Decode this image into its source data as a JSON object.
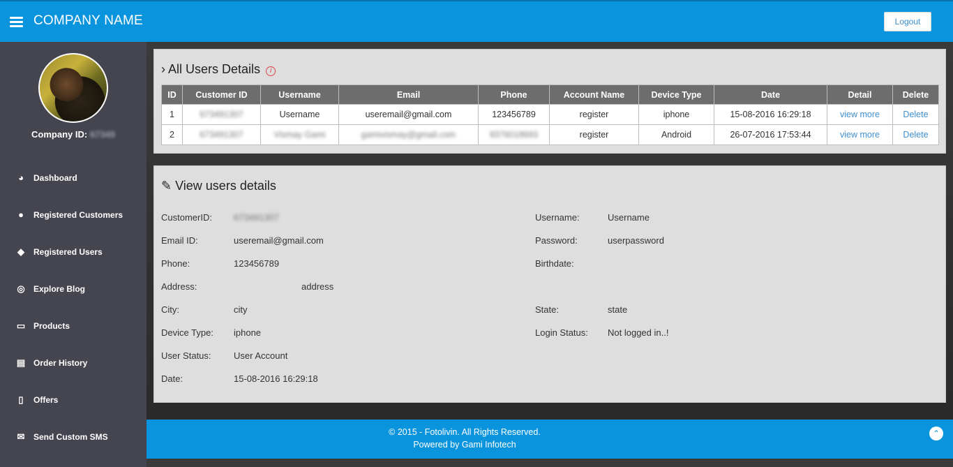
{
  "header": {
    "menu_icon": "hamburger-icon",
    "brand": "COMPANY NAME",
    "logout_label": "Logout"
  },
  "sidebar": {
    "company_id_label": "Company ID:",
    "company_id_value": "67349",
    "items": [
      {
        "label": "Dashboard",
        "icon": "dashboard-icon",
        "glyph": "◕"
      },
      {
        "label": "Registered Customers",
        "icon": "user-icon",
        "glyph": "●"
      },
      {
        "label": "Registered Users",
        "icon": "users-icon",
        "glyph": "◆"
      },
      {
        "label": "Explore Blog",
        "icon": "compass-icon",
        "glyph": "◎"
      },
      {
        "label": "Products",
        "icon": "product-icon",
        "glyph": "▭"
      },
      {
        "label": "Order History",
        "icon": "book-icon",
        "glyph": "▤"
      },
      {
        "label": "Offers",
        "icon": "mobile-icon",
        "glyph": "▯"
      },
      {
        "label": "Send Custom SMS",
        "icon": "envelope-icon",
        "glyph": "✉"
      }
    ]
  },
  "users_panel": {
    "title": "All Users Details",
    "columns": [
      "ID",
      "Customer ID",
      "Username",
      "Email",
      "Phone",
      "Account Name",
      "Device Type",
      "Date",
      "Detail",
      "Delete"
    ],
    "rows": [
      {
        "id": "1",
        "customer_id": "673491307",
        "username": "Username",
        "email": "useremail@gmail.com",
        "phone": "123456789",
        "account_name": "register",
        "device_type": "iphone",
        "date": "15-08-2016 16:29:18",
        "detail": "view more",
        "delete": "Delete"
      },
      {
        "id": "2",
        "customer_id": "673491307",
        "username": "Vismay Gami",
        "email": "gamivismay@gmail.com",
        "phone": "9376018693",
        "account_name": "register",
        "device_type": "Android",
        "date": "26-07-2016 17:53:44",
        "detail": "view more",
        "delete": "Delete"
      }
    ]
  },
  "details_panel": {
    "title": "View users details",
    "left": [
      {
        "label": "CustomerID:",
        "value": "673491307"
      },
      {
        "label": "Email ID:",
        "value": "useremail@gmail.com"
      },
      {
        "label": "Phone:",
        "value": "123456789"
      },
      {
        "label": "Address:",
        "value": "address"
      },
      {
        "label": "City:",
        "value": "city"
      },
      {
        "label": "Device Type:",
        "value": "iphone"
      },
      {
        "label": "User Status:",
        "value": "User Account"
      },
      {
        "label": "Date:",
        "value": "15-08-2016 16:29:18"
      }
    ],
    "right": [
      {
        "label": "Username:",
        "value": "Username"
      },
      {
        "label": "Password:",
        "value": "userpassword"
      },
      {
        "label": "Birthdate:",
        "value": ""
      },
      {
        "label": "State:",
        "value": "state"
      },
      {
        "label": "Login Status:",
        "value": "Not logged in..!"
      }
    ]
  },
  "footer": {
    "copyright": "© 2015 - Fotolivin. All Rights Reserved.",
    "powered_by": "Powered by Gami Infotech",
    "scroll_top_glyph": "⌃"
  },
  "colors": {
    "header_bg": "#0a94dd",
    "sidebar_bg": "#45454f",
    "panel_bg": "#dedede",
    "table_header_bg": "#6d6d6d",
    "link": "#3f8fcf",
    "info_icon": "#e0434b"
  }
}
